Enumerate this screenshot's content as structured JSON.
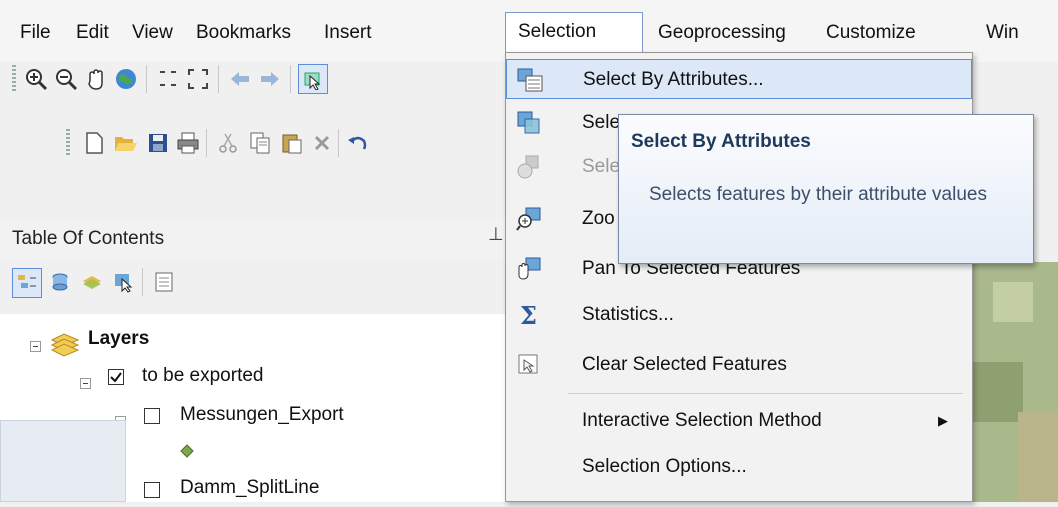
{
  "menubar": {
    "items": [
      "File",
      "Edit",
      "View",
      "Bookmarks",
      "Insert",
      "Selection",
      "Geoprocessing",
      "Customize",
      "Windows"
    ],
    "visible_labels": [
      "File",
      "Edit",
      "View",
      "Bookmarks",
      "Insert",
      "Selection",
      "Geoprocessing",
      "Customize",
      "Win"
    ]
  },
  "toolbar1": {
    "icons": [
      "zoom-in-icon",
      "zoom-out-icon",
      "pan-icon",
      "full-extent-icon",
      "fixed-zoom-in-icon",
      "fixed-zoom-out-icon",
      "back-icon",
      "forward-icon",
      "select-features-icon"
    ]
  },
  "toolbar2": {
    "icons": [
      "new-document-icon",
      "open-icon",
      "save-icon",
      "print-icon",
      "cut-icon",
      "copy-icon",
      "paste-icon",
      "delete-icon",
      "undo-icon"
    ]
  },
  "toc": {
    "title": "Table Of Contents",
    "pin": "§",
    "tree": {
      "layers_label": "Layers",
      "group_label": "to be exported",
      "layer1_label": "Messungen_Export",
      "layer2_label": "Damm_SplitLine"
    }
  },
  "selection_menu": {
    "items": [
      {
        "label": "Select By Attributes...",
        "icon": "select-by-attributes-icon",
        "state": "hover"
      },
      {
        "label": "Sele",
        "icon": "select-by-location-icon",
        "state": "normal"
      },
      {
        "label": "Sele",
        "icon": "select-by-graphics-icon",
        "state": "disabled"
      },
      {
        "label": "Zoo",
        "icon": "zoom-to-selected-icon",
        "state": "normal"
      },
      {
        "label": "Pan To Selected Features",
        "icon": "pan-to-selected-icon",
        "state": "normal"
      },
      {
        "label": "Statistics...",
        "icon": "statistics-icon",
        "state": "normal"
      },
      {
        "label": "Clear Selected Features",
        "icon": "clear-selection-icon",
        "state": "normal"
      },
      {
        "label": "Interactive Selection Method",
        "icon": "",
        "state": "submenu"
      },
      {
        "label": "Selection Options...",
        "icon": "",
        "state": "normal"
      }
    ]
  },
  "tooltip": {
    "title": "Select By Attributes",
    "body": "Selects features by their attribute values"
  },
  "colors": {
    "hover_bg": "#dce8f8",
    "hover_border": "#5d8fd8",
    "tooltip_title": "#1e395b"
  }
}
